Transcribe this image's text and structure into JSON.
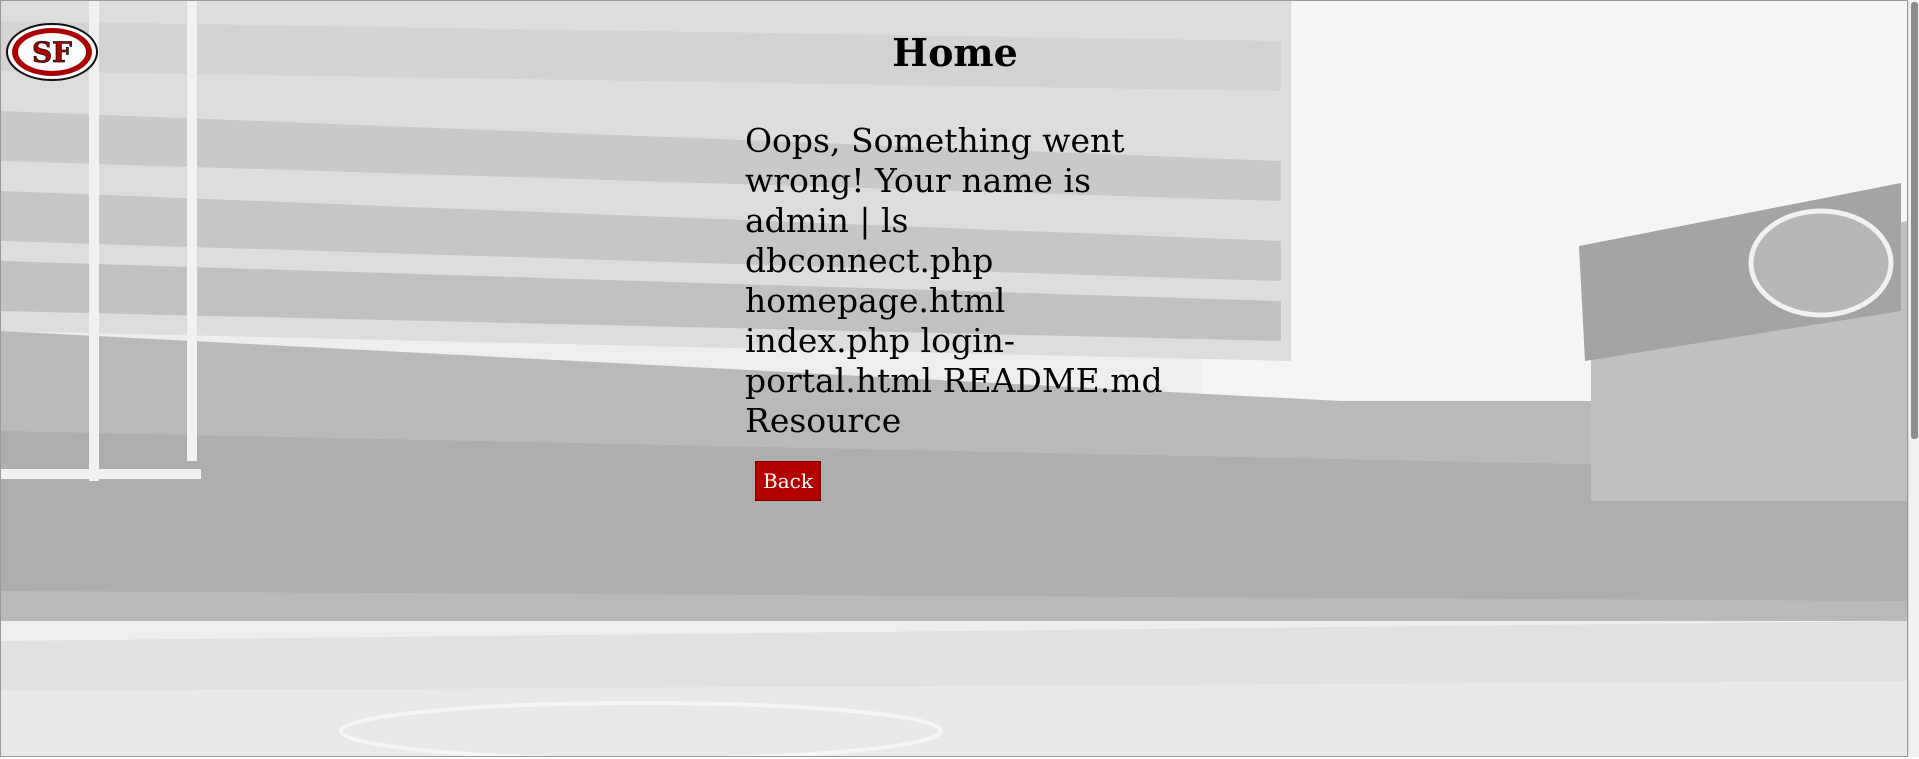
{
  "page": {
    "title": "Home"
  },
  "logo": {
    "name": "49ers-sf-logo",
    "text": "SF"
  },
  "result": {
    "message": "Oops, Something went wrong! Your name is admin | ls dbconnect.php homepage.html index.php login-portal.html README.md Resource"
  },
  "buttons": {
    "back_label": "Back"
  },
  "colors": {
    "button_bg": "#b20000",
    "logo_red": "#aa0000",
    "logo_gold": "#b3995d",
    "text": "#000000"
  }
}
